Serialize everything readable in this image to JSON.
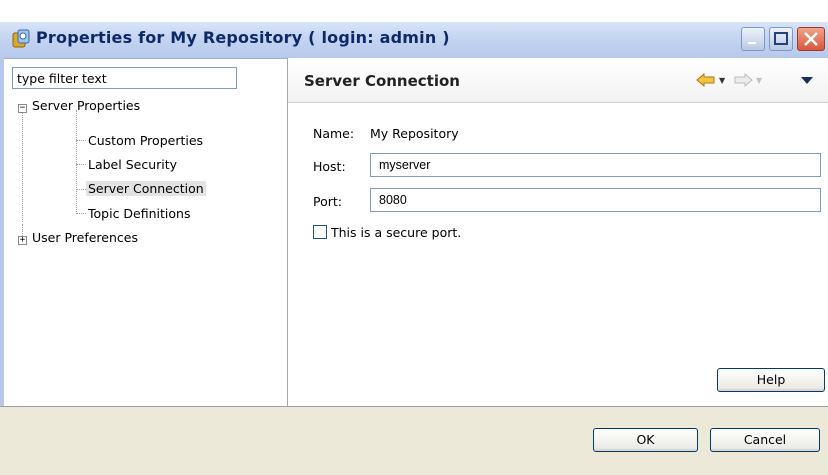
{
  "window": {
    "title": "Properties for My Repository ( login: admin )",
    "buttons": {
      "minimize": "_",
      "maximize": "□",
      "close": "✕"
    }
  },
  "filter": {
    "placeholder": "type filter text"
  },
  "tree": {
    "items": [
      {
        "label": "Server Properties",
        "expanded": true
      },
      {
        "label": "Custom Properties"
      },
      {
        "label": "Label Security"
      },
      {
        "label": "Server Connection",
        "selected": true
      },
      {
        "label": "Topic Definitions"
      },
      {
        "label": "User Preferences",
        "expanded": false
      }
    ],
    "collapse_glyph": "−",
    "expand_glyph": "+"
  },
  "page": {
    "title": "Server Connection",
    "name_label": "Name:",
    "name_value": "My Repository",
    "host_label": "Host:",
    "host_value": "myserver",
    "port_label": "Port:",
    "port_value": "8080",
    "secure_label": "This is a secure port.",
    "secure_checked": false,
    "help_label": "Help"
  },
  "footer": {
    "ok_label": "OK",
    "cancel_label": "Cancel"
  },
  "colors": {
    "title_text": "#0e2a66",
    "back_arrow": "#f2b21b",
    "close_button": "#d9563b"
  }
}
